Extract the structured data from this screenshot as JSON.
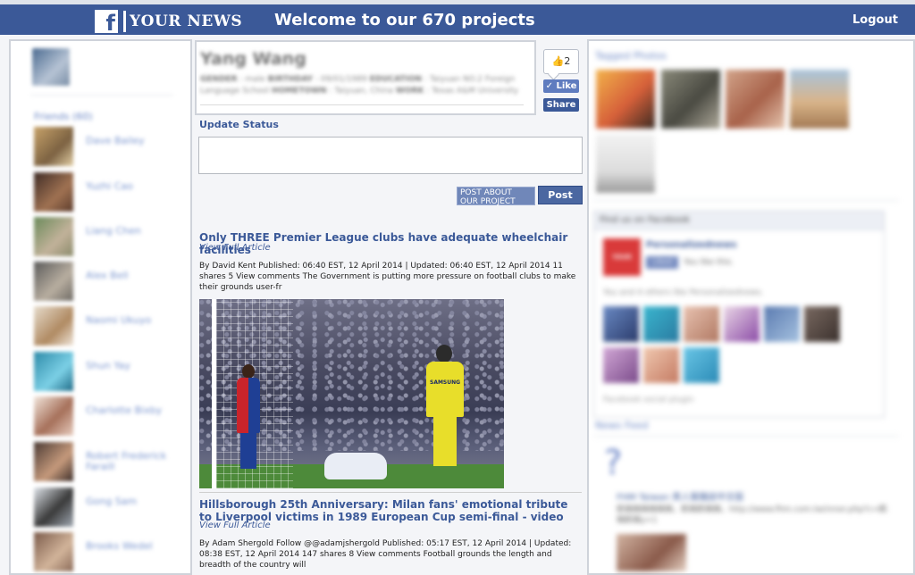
{
  "header": {
    "brand_name": "YOUR NEWS",
    "welcome": "Welcome to our 670 projects",
    "logout": "Logout",
    "bg_color": "#3b5998"
  },
  "profile": {
    "name": "Yang Wang",
    "gender_label": "GENDER",
    "gender": "male",
    "birthday_label": "BIRTHDAY",
    "birthday": "09/01/1989",
    "education_label": "EDUCATION",
    "education": "Taiyuan NO.2 Foreign Language School",
    "hometown_label": "HOMETOWN",
    "hometown": "Taiyuan, China",
    "work_label": "WORK",
    "work": "Texas A&M University"
  },
  "like_widget": {
    "count": "2",
    "like_label": "Like",
    "share_label": "Share"
  },
  "status": {
    "heading": "Update Status",
    "placeholder": "",
    "post_about_label": "POST ABOUT OUR PROJECT",
    "post_label": "Post"
  },
  "articles": [
    {
      "title": "Only THREE Premier League clubs have adequate wheelchair facilities",
      "link": "View Full Article",
      "body": "By David Kent Published: 06:40 EST, 12 April 2014 | Updated: 06:40 EST, 12 April 2014 11 shares 5 View comments The Government is putting more pressure on football clubs to make their grounds user-fr"
    },
    {
      "title": "Hillsborough 25th Anniversary: Milan fans' emotional tribute to Liverpool victims in 1989 European Cup semi-final - video",
      "link": "View Full Article",
      "body": "By Adam Shergold Follow @@adamjshergold Published: 05:17 EST, 12 April 2014 | Updated: 08:38 EST, 12 April 2014 147 shares 8 View comments Football grounds the length and breadth of the country will"
    }
  ],
  "photo_text": {
    "sponsor": "SAMSUNG"
  },
  "sidebar": {
    "friends_heading": "Friends (60)",
    "friends": [
      "Dave Bailey",
      "Yuzhi Cao",
      "Liang Chen",
      "Alex Bell",
      "Naomi Ukuyo",
      "Shun Yay",
      "Charlotte Bixby",
      "Robert Frederick Faraill",
      "Gong Sam",
      "Brooks Wedel"
    ]
  },
  "right": {
    "tagged_heading": "Tagged Photos",
    "find_us": "Find us on Facebook",
    "page_name": "Personalizednews",
    "page_logo_text": "YOUR NEWS",
    "page_like": "Liked",
    "you_like": "You like this.",
    "also_like": "You and 4 others like Personalizednews.",
    "social_plugin": "Facebook social plugin",
    "news_feed": "News Feed",
    "feed_title": "FHM Taiwan 男人幫雜誌中文版",
    "feed_text": "凱稱稱稱稱稱稱，凱稱凱稱稱，http://www.fhm.com.tw/inner.php?c=凱稱凱稱y=1"
  }
}
